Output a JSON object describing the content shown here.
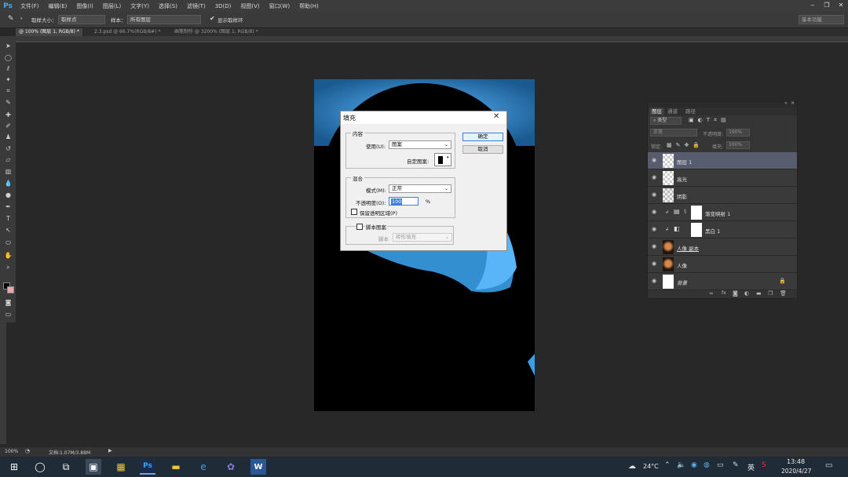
{
  "menubar": {
    "logo": "Ps",
    "items": [
      "文件(F)",
      "编辑(E)",
      "图像(I)",
      "图层(L)",
      "文字(Y)",
      "选择(S)",
      "滤镜(T)",
      "3D(D)",
      "视图(V)",
      "窗口(W)",
      "帮助(H)"
    ],
    "window_controls": [
      "‒",
      "❐",
      "✕"
    ]
  },
  "optionsbar": {
    "sample_size_label": "取样大小：",
    "sample_size_value": "取样点",
    "sample_label": "样本：",
    "sample_value": "所有图层",
    "show_ring_label": "显示取样环",
    "workspace": "基本功能"
  },
  "tabs": [
    {
      "label": "@ 100% (图层 1, RGB/8) *",
      "active": true
    },
    {
      "label": "2.3.psd @ 66.7%(RGB/8#) *",
      "active": false
    },
    {
      "label": "画笔制作 @ 3200% (图层 1, RGB/8) *",
      "active": false
    }
  ],
  "dialog": {
    "title": "填充",
    "content_group": "内容",
    "use_label": "使用(U):",
    "use_value": "图案",
    "custom_pattern_label": "自定图案:",
    "blend_group": "混合",
    "mode_label": "模式(M):",
    "mode_value": "正常",
    "opacity_label": "不透明度(O):",
    "opacity_value": "100",
    "opacity_unit": "%",
    "preserve_label": "保留透明区域(P)",
    "script_label": "脚本图案",
    "script_field_label": "脚本",
    "script_value": "砖形填充",
    "ok": "确定",
    "cancel": "取消"
  },
  "layers_panel": {
    "tabs": [
      "图层",
      "通道",
      "路径"
    ],
    "kind_label": "类型",
    "blend_mode": "正常",
    "opacity_label": "不透明度:",
    "opacity_value": "100%",
    "lock_label": "锁定:",
    "fill_label": "填充:",
    "fill_value": "100%",
    "layers": [
      {
        "name": "图层 1",
        "selected": true
      },
      {
        "name": "高光",
        "selected": false
      },
      {
        "name": "阴影",
        "selected": false
      },
      {
        "name": "渐变映射 1",
        "selected": false
      },
      {
        "name": "黑白 1",
        "selected": false
      },
      {
        "name": "人像 副本",
        "selected": false
      },
      {
        "name": "人像",
        "selected": false
      },
      {
        "name": "背景",
        "selected": false
      }
    ]
  },
  "statusbar": {
    "zoom": "100%",
    "doc_info": "文档:1.07M/3.88M"
  },
  "taskbar": {
    "temperature": "24°C",
    "ime": "英",
    "time": "13:48",
    "date": "2020/4/27"
  },
  "colors": {
    "accent_blue": "#3c7fd8",
    "selected_layer": "#575c6e",
    "canvas_blue": "#2a7fc0"
  }
}
